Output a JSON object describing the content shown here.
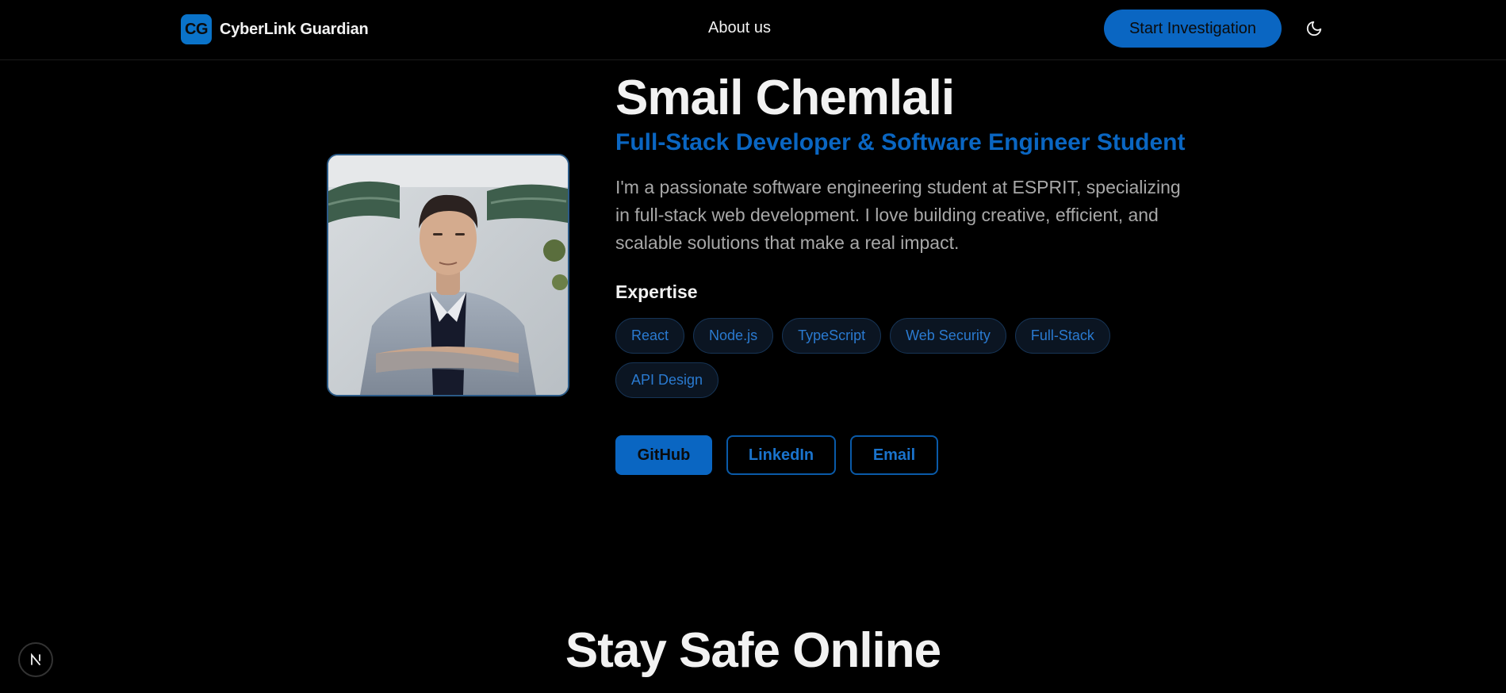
{
  "nav": {
    "brand_logo": "CG",
    "brand_name": "CyberLink Guardian",
    "about_link": "About us",
    "cta_label": "Start Investigation",
    "theme_icon": "moon-icon"
  },
  "profile": {
    "name": "Smail Chemlali",
    "role": "Full-Stack Developer & Software Engineer Student",
    "bio": "I'm a passionate software engineering student at ESPRIT, specializing in full-stack web development. I love building creative, efficient, and scalable solutions that make a real impact.",
    "expertise_title": "Expertise",
    "tags": [
      "React",
      "Node.js",
      "TypeScript",
      "Web Security",
      "Full-Stack",
      "API Design"
    ],
    "links": {
      "github": "GitHub",
      "linkedin": "LinkedIn",
      "email": "Email"
    }
  },
  "section": {
    "title": "Stay Safe Online"
  },
  "dev_badge": {
    "icon": "nextjs-logo-icon"
  },
  "colors": {
    "accent": "#0a66c2",
    "background": "#000000",
    "text": "#f2f2f2",
    "muted": "#a8a8a8"
  }
}
